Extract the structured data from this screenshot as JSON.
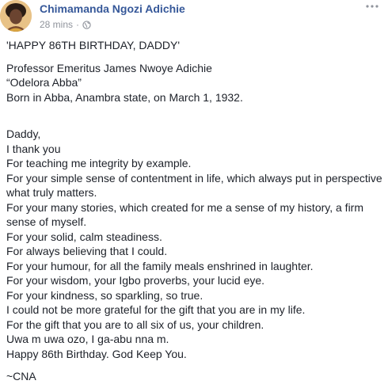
{
  "post": {
    "author": "Chimamanda Ngozi Adichie",
    "timestamp": "28 mins",
    "separator": "·",
    "privacy_icon": "globe-icon",
    "more_icon": "more-options-icon",
    "paragraphs": [
      [
        "'HAPPY 86TH BIRTHDAY, DADDY'"
      ],
      [
        "Professor Emeritus James Nwoye Adichie",
        "“Odelora Abba”",
        "Born in Abba, Anambra state, on March 1, 1932."
      ],
      [
        "Daddy,",
        "I thank you",
        "For teaching me integrity by example.",
        "For your simple sense of contentment in life, which always put in perspective what truly matters.",
        "For your many stories, which created for me a sense of my history, a firm sense of myself.",
        "For your solid, calm steadiness.",
        "For always believing that I could.",
        "For your humour, for all the family meals enshrined in laughter.",
        "For your wisdom, your Igbo proverbs, your lucid eye.",
        "For your kindness, so sparkling, so true.",
        "I could not be more grateful for the gift that you are in my life.",
        "For the gift that you are to all six of us, your children.",
        "Uwa m uwa ozo, I ga-abu nna m.",
        "Happy 86th Birthday. God Keep You."
      ],
      [
        "~CNA"
      ]
    ]
  }
}
